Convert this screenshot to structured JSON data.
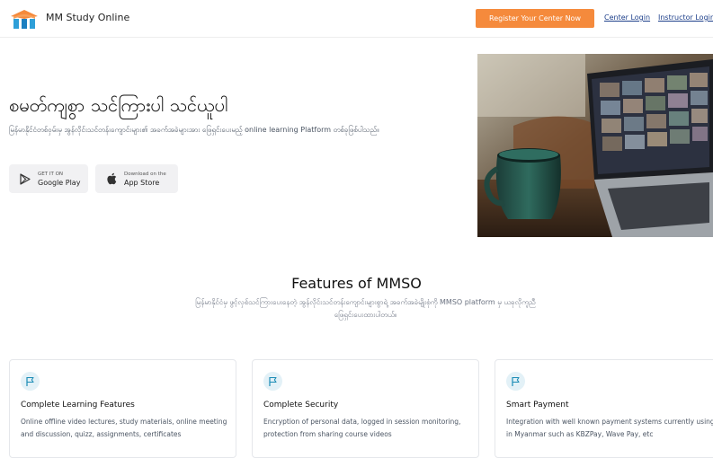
{
  "header": {
    "brand": "MM Study Online",
    "register_label": "Register Your Center Now",
    "center_login": "Center Login",
    "instructor_login": "Instructor Login"
  },
  "hero": {
    "title": "စမတ်ကျစွာ သင်ကြားပါ သင်ယူပါ",
    "description": "မြန်မာနိုင်ငံတစ်ဝှမ်းမှ အွန်လိုင်းသင်တန်းကျောင်းများ၏ အခက်အခဲများအား ဖြေရှင်းပေးမည့် online learning Platform တစ်ခုဖြစ်ပါသည်။",
    "google_play": {
      "small": "GET IT ON",
      "big": "Google Play",
      "icon": "google-play-icon"
    },
    "app_store": {
      "small": "Download on the",
      "big": "App Store",
      "icon": "apple-icon"
    }
  },
  "features": {
    "title": "Features of MMSO",
    "subtitle": "မြန်မာနိုင်ငံမှ ဖွင့်လှစ်သင်ကြားပေးနေတဲ့ အွန်လိုင်းသင်တန်းကျောင်းများစွာရဲ့ အခက်အခဲမျိုးစုံကို MMSO platform မှ ယခုလိုကူညီဖြေရှင်းပေးထားပါတယ်။",
    "cards": [
      {
        "title": "Complete Learning Features",
        "description": "Online offline video lectures, study materials, online meeting and discussion, quizz, assignments, certificates",
        "icon": "flag-icon"
      },
      {
        "title": "Complete Security",
        "description": "Encryption of personal data, logged in session monitoring, protection from sharing course videos",
        "icon": "flag-icon"
      },
      {
        "title": "Smart Payment",
        "description": "Integration with well known payment systems currently using in Myanmar such as KBZPay, Wave Pay, etc",
        "icon": "flag-icon"
      }
    ]
  },
  "colors": {
    "accent": "#f58a3c",
    "link": "#1d3f8a",
    "icon_bg": "#e3f1f7",
    "icon_fg": "#1a8bb5"
  }
}
